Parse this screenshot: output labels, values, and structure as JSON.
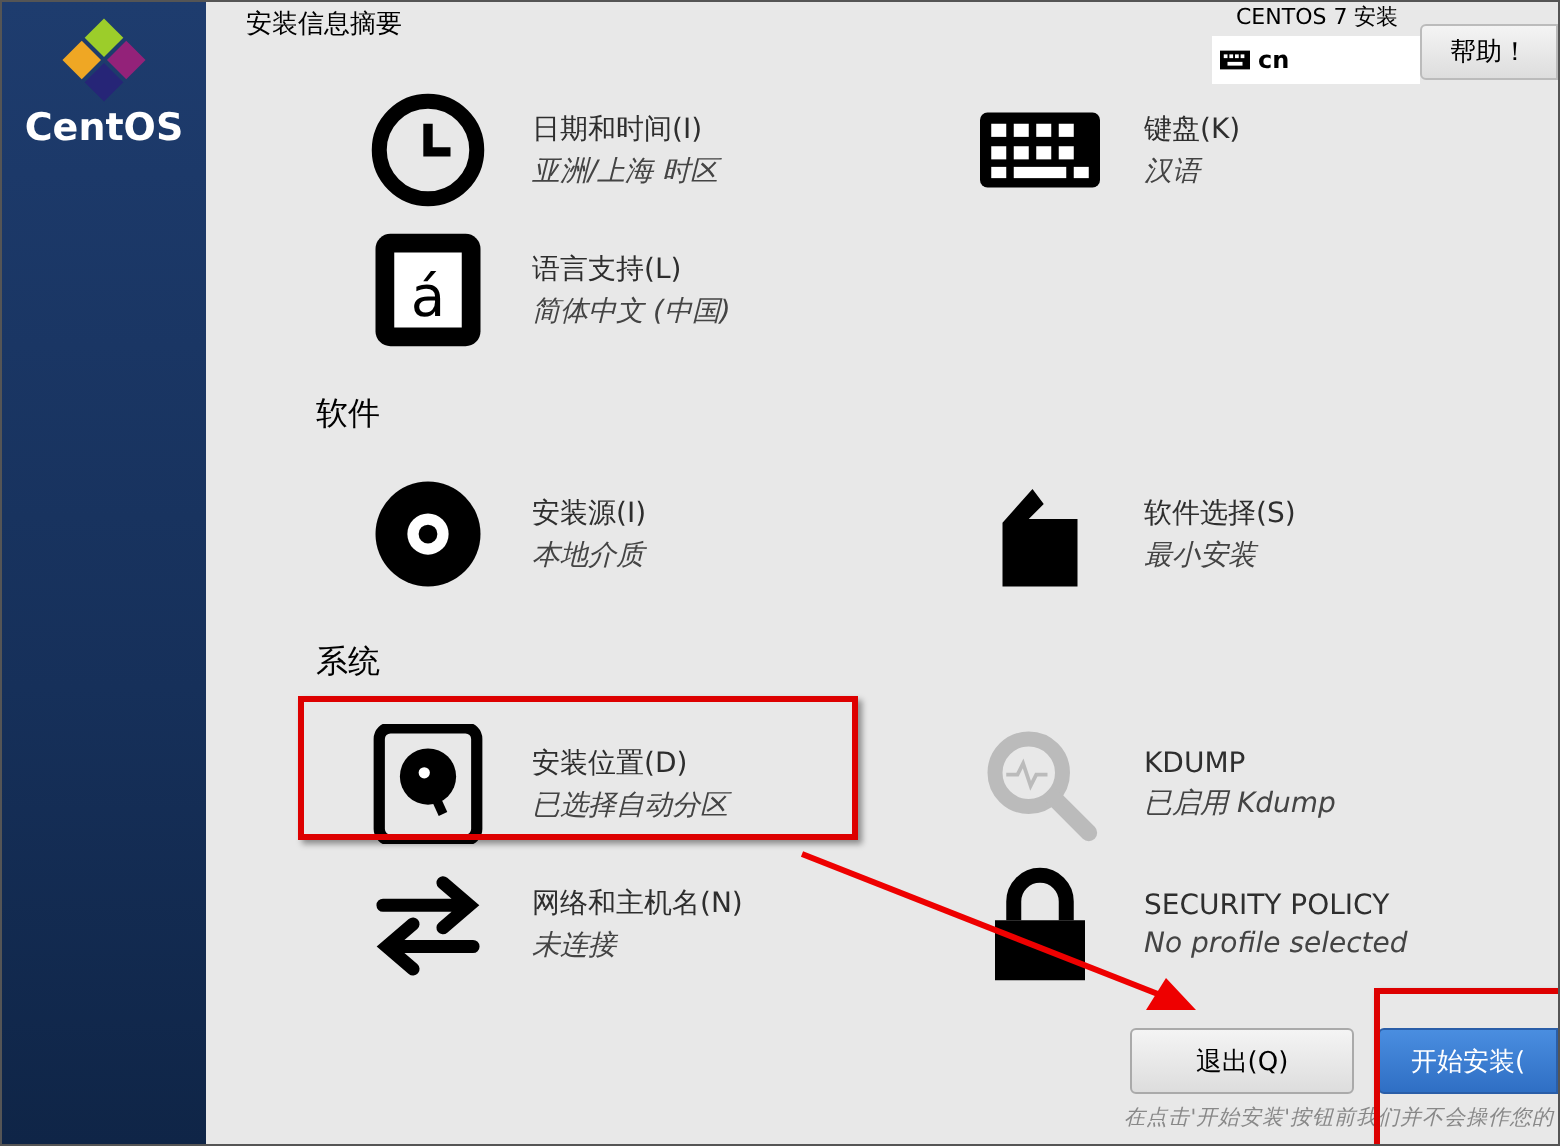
{
  "sidebar": {
    "logo_text": "CentOS"
  },
  "header": {
    "title": "安装信息摘要",
    "product": "CENTOS 7 安装",
    "keyboard": "cn",
    "help": "帮助！"
  },
  "top_items": [
    {
      "kind": "clock",
      "title": "日期和时间(I)",
      "status": "亚洲/上海 时区"
    },
    {
      "kind": "keyboard",
      "title": "键盘(K)",
      "status": "汉语"
    },
    {
      "kind": "language",
      "glyph": "á",
      "title": "语言支持(L)",
      "status": "简体中文 (中国)"
    }
  ],
  "sections": [
    {
      "heading": "软件",
      "items": [
        {
          "kind": "disc",
          "title": "安装源(I)",
          "status": "本地介质"
        },
        {
          "kind": "package",
          "title": "软件选择(S)",
          "status": "最小安装"
        }
      ]
    },
    {
      "heading": "系统",
      "items": [
        {
          "kind": "disk",
          "title": "安装位置(D)",
          "status": "已选择自动分区"
        },
        {
          "kind": "magnifier",
          "title": "KDUMP",
          "status": "已启用 Kdump"
        },
        {
          "kind": "network",
          "title": "网络和主机名(N)",
          "status": "未连接"
        },
        {
          "kind": "lock",
          "title": "SECURITY POLICY",
          "status": "No profile selected"
        }
      ]
    }
  ],
  "buttons": [
    {
      "label": "退出(Q)",
      "kind": "secondary"
    },
    {
      "label": "开始安装(",
      "kind": "primary"
    }
  ],
  "footer_note": "在点击'开始安装'按钮前我们并不会操作您的"
}
